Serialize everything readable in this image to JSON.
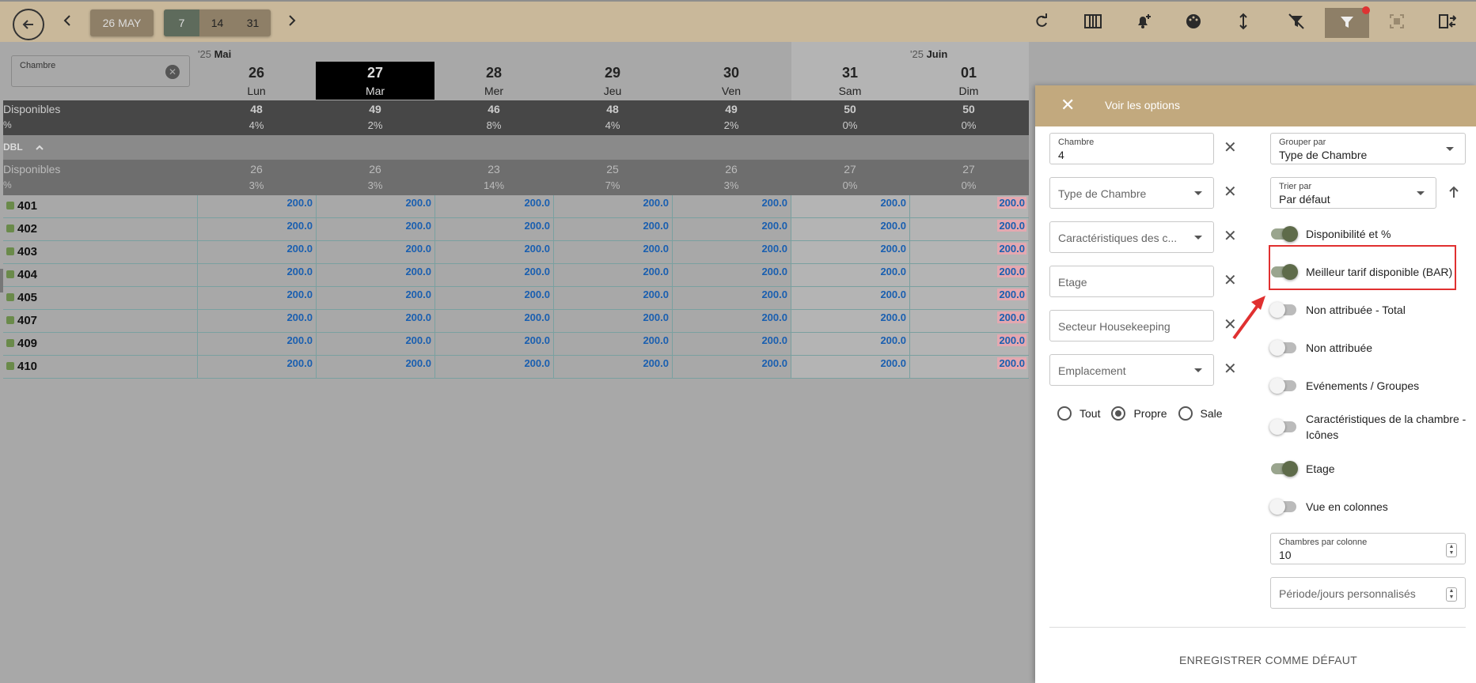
{
  "toolbar": {
    "date_label": "26 MAY",
    "segments": [
      "7",
      "14",
      "31"
    ],
    "icons": [
      "arrow-left-icon",
      "chevron-left-icon",
      "chevron-right-icon",
      "refresh-icon",
      "columns-icon",
      "bell-plus-icon",
      "palette-icon",
      "resize-vertical-icon",
      "filter-off-icon",
      "filter-icon",
      "screenshot-icon",
      "swap-icon"
    ]
  },
  "search": {
    "label": "Chambre",
    "clear_icon": "clear-circle-icon"
  },
  "months": [
    {
      "year": "'25",
      "name": "Mai"
    },
    {
      "year": "'25",
      "name": "Juin"
    }
  ],
  "days": [
    {
      "num": "26",
      "wd": "Lun"
    },
    {
      "num": "27",
      "wd": "Mar"
    },
    {
      "num": "28",
      "wd": "Mer"
    },
    {
      "num": "29",
      "wd": "Jeu"
    },
    {
      "num": "30",
      "wd": "Ven"
    },
    {
      "num": "31",
      "wd": "Sam"
    },
    {
      "num": "01",
      "wd": "Dim"
    }
  ],
  "totals": {
    "available_label": "Disponibles",
    "pct_label": "%",
    "available": [
      "48",
      "49",
      "46",
      "48",
      "49",
      "50",
      "50"
    ],
    "pct": [
      "4%",
      "2%",
      "8%",
      "4%",
      "2%",
      "0%",
      "0%"
    ]
  },
  "group": {
    "name": "DBL",
    "available_label": "Disponibles",
    "pct_label": "%",
    "available": [
      "26",
      "26",
      "23",
      "25",
      "26",
      "27",
      "27"
    ],
    "pct": [
      "3%",
      "3%",
      "14%",
      "7%",
      "3%",
      "0%",
      "0%"
    ]
  },
  "rooms": [
    {
      "name": "401",
      "rates": [
        "200.0",
        "200.0",
        "200.0",
        "200.0",
        "200.0",
        "200.0",
        "200.0"
      ]
    },
    {
      "name": "402",
      "rates": [
        "200.0",
        "200.0",
        "200.0",
        "200.0",
        "200.0",
        "200.0",
        "200.0"
      ]
    },
    {
      "name": "403",
      "rates": [
        "200.0",
        "200.0",
        "200.0",
        "200.0",
        "200.0",
        "200.0",
        "200.0"
      ]
    },
    {
      "name": "404",
      "rates": [
        "200.0",
        "200.0",
        "200.0",
        "200.0",
        "200.0",
        "200.0",
        "200.0"
      ]
    },
    {
      "name": "405",
      "rates": [
        "200.0",
        "200.0",
        "200.0",
        "200.0",
        "200.0",
        "200.0",
        "200.0"
      ]
    },
    {
      "name": "407",
      "rates": [
        "200.0",
        "200.0",
        "200.0",
        "200.0",
        "200.0",
        "200.0",
        "200.0"
      ]
    },
    {
      "name": "409",
      "rates": [
        "200.0",
        "200.0",
        "200.0",
        "200.0",
        "200.0",
        "200.0",
        "200.0"
      ]
    },
    {
      "name": "410",
      "rates": [
        "200.0",
        "200.0",
        "200.0",
        "200.0",
        "200.0",
        "200.0",
        "200.0"
      ]
    }
  ],
  "panel": {
    "title": "Voir les options",
    "chambre": {
      "label": "Chambre",
      "value": "4"
    },
    "type_chambre": "Type de Chambre",
    "caracteristiques": "Caractéristiques des c...",
    "etage": "Etage",
    "secteur": "Secteur Housekeeping",
    "emplacement": "Emplacement",
    "radios": [
      "Tout",
      "Propre",
      "Sale"
    ],
    "radio_selected": "Propre",
    "grouper": {
      "label": "Grouper par",
      "value": "Type de Chambre"
    },
    "trier": {
      "label": "Trier par",
      "value": "Par défaut"
    },
    "toggles": [
      {
        "label": "Disponibilité et %",
        "on": true
      },
      {
        "label": "Meilleur tarif disponible (BAR)",
        "on": true
      },
      {
        "label": "Non attribuée - Total",
        "on": false
      },
      {
        "label": "Non attribuée",
        "on": false
      },
      {
        "label": "Evénements / Groupes",
        "on": false
      },
      {
        "label": "Caractéristiques de la chambre -",
        "label2": "Icônes",
        "on": false
      },
      {
        "label": "Etage",
        "on": true
      },
      {
        "label": "Vue en colonnes",
        "on": false
      }
    ],
    "chambres_par_colonne": {
      "label": "Chambres par colonne",
      "value": "10"
    },
    "periode": "Période/jours personnalisés",
    "save_label": "ENREGISTRER COMME DÉFAUT"
  },
  "colors": {
    "toolbar": "#c9b89a",
    "panel_head": "#c2a97e",
    "rate": "#1a5fb0",
    "highlight": "#e03030"
  }
}
